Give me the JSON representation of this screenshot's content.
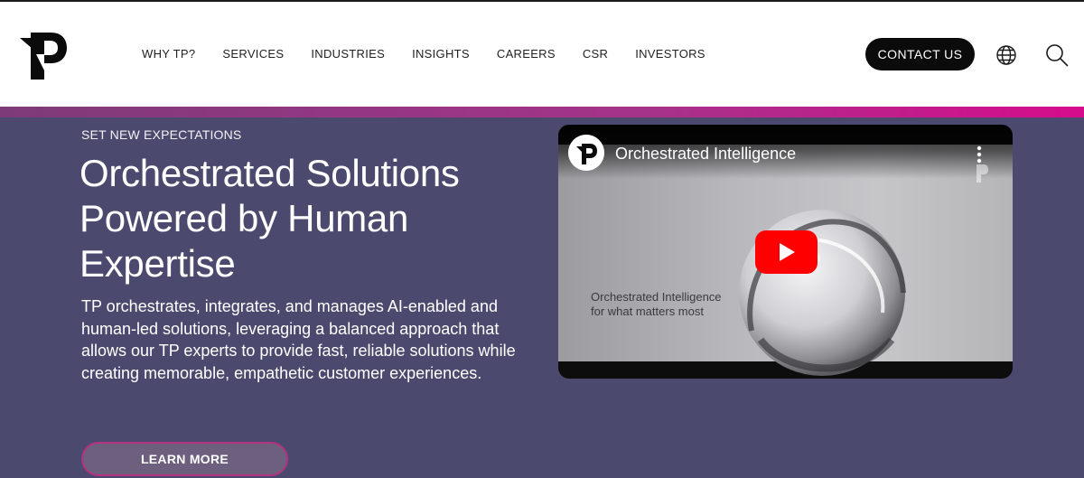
{
  "header": {
    "nav": [
      {
        "label": "WHY TP?"
      },
      {
        "label": "SERVICES"
      },
      {
        "label": "INDUSTRIES"
      },
      {
        "label": "INSIGHTS"
      },
      {
        "label": "CAREERS"
      },
      {
        "label": "CSR"
      },
      {
        "label": "INVESTORS"
      }
    ],
    "contact_label": "CONTACT US",
    "icons": [
      "globe-icon",
      "search-icon"
    ]
  },
  "hero": {
    "eyebrow": "SET NEW EXPECTATIONS",
    "headline_lines": [
      "Orchestrated Solutions",
      "Powered by Human",
      "Expertise"
    ],
    "body": "TP orchestrates, integrates, and manages AI-enabled and human-led solutions, leveraging a balanced approach that allows our TP experts to provide fast, reliable solutions while creating memorable, empathetic customer experiences.",
    "cta_label": "LEARN MORE"
  },
  "video": {
    "title": "Orchestrated Intelligence",
    "caption_lines": [
      "Orchestrated Intelligence",
      "for what matters most"
    ]
  },
  "colors": {
    "hero_bg": "#4b4a6e",
    "accent_start": "#7e3b79",
    "accent_end": "#d60c8c",
    "contact_bg": "#0b0b0b",
    "play_red": "#ff0000"
  }
}
